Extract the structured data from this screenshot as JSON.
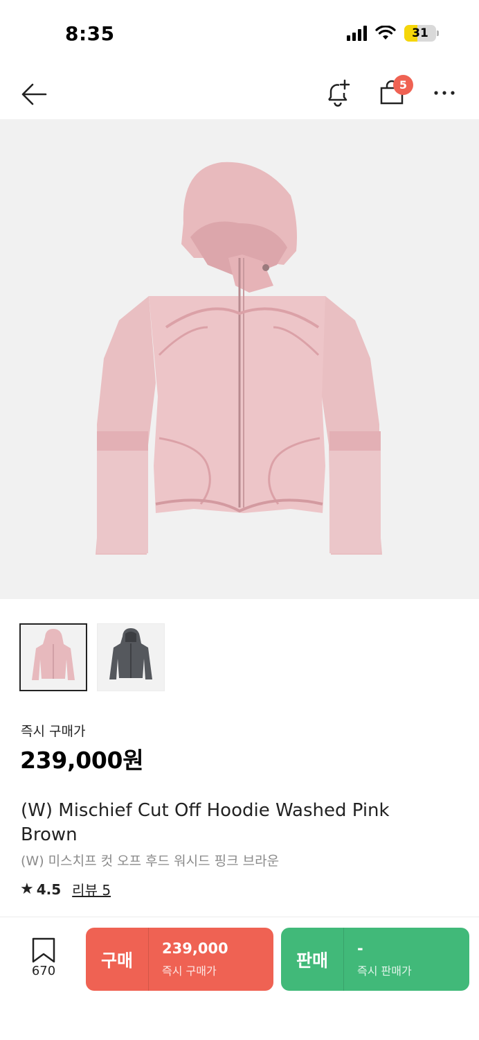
{
  "status_bar": {
    "time": "8:35",
    "battery_level": "31",
    "battery_color": "#f5d60a"
  },
  "nav": {
    "back_icon": "arrow-left-icon",
    "alert_icon": "bell-plus-icon",
    "bag_icon": "shopping-bag-icon",
    "bag_badge": "5",
    "more_icon": "more-horizontal-icon"
  },
  "hero": {
    "image": "pink-washed-hoodie-photo"
  },
  "thumbnails": [
    {
      "color": "pink",
      "selected": true
    },
    {
      "color": "charcoal",
      "selected": false
    }
  ],
  "product": {
    "price_label": "즉시 구매가",
    "price": "239,000원",
    "title_en": "(W) Mischief Cut Off Hoodie Washed Pink Brown",
    "title_ko": "(W) 미스치프 컷 오프 후드 워시드 핑크 브라운",
    "rating": "4.5",
    "review_label": "리뷰 5"
  },
  "bottom_bar": {
    "wish_count": "670",
    "buy": {
      "label": "구매",
      "amount": "239,000",
      "sub": "즉시 구매가",
      "color": "#ef6253"
    },
    "sell": {
      "label": "판매",
      "amount": "-",
      "sub": "즉시 판매가",
      "color": "#41b979"
    }
  }
}
